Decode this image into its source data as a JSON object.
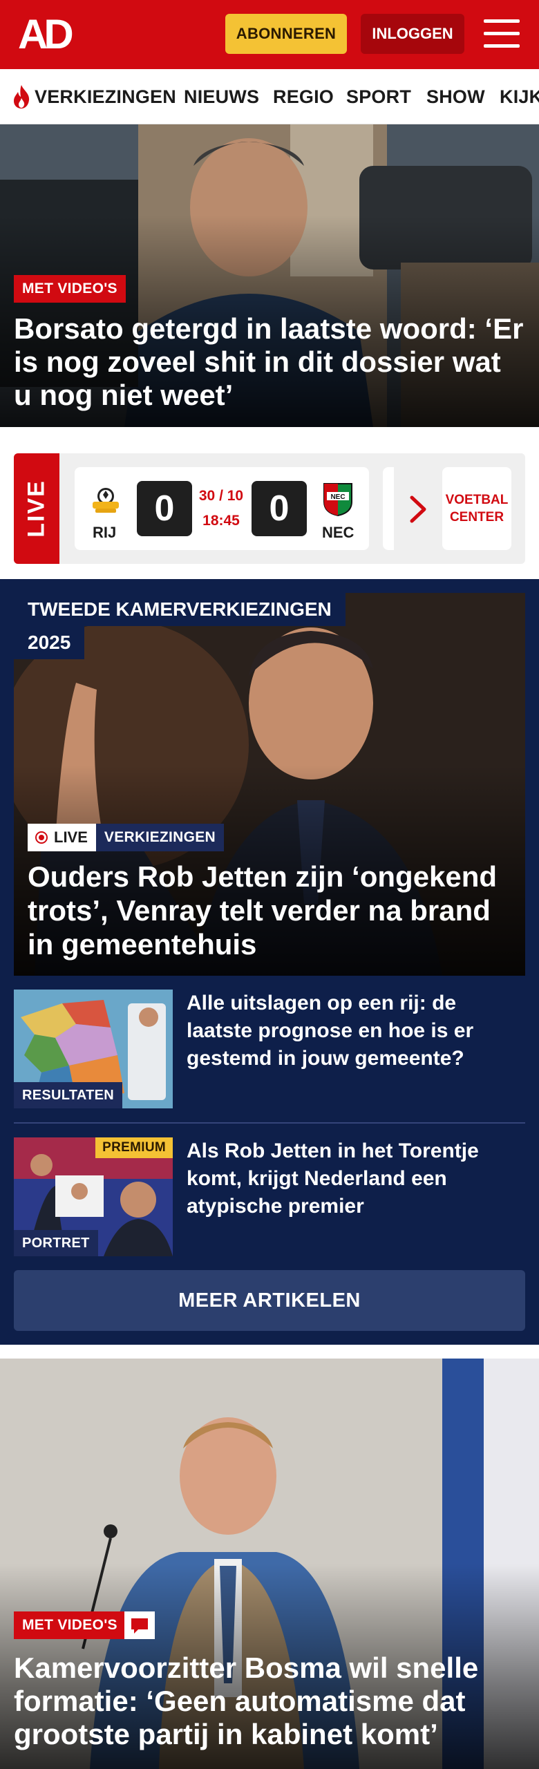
{
  "header": {
    "logo_text": "AD",
    "subscribe_label": "ABONNEREN",
    "login_label": "INLOGGEN",
    "brand_color": "#d10a11"
  },
  "nav": {
    "items": [
      {
        "label": "VERKIEZINGEN",
        "icon": "flame-icon"
      },
      {
        "label": "NIEUWS"
      },
      {
        "label": "REGIO"
      },
      {
        "label": "SPORT"
      },
      {
        "label": "SHOW"
      },
      {
        "label": "KIJK"
      }
    ]
  },
  "hero": {
    "badge": "MET VIDEO'S",
    "title": "Borsato getergd in laatste woord: ‘Er is nog zoveel shit in dit dossier wat u nog niet weet’"
  },
  "live_widget": {
    "tab_label": "LIVE",
    "match": {
      "home_team": "RIJ",
      "away_team": "NEC",
      "home_score": "0",
      "away_score": "0",
      "date": "30 / 10",
      "time": "18:45"
    },
    "center_label_line1": "VOETBAL",
    "center_label_line2": "CENTER"
  },
  "election": {
    "section_label_line1": "TWEEDE KAMERVERKIEZINGEN",
    "section_label_line2": "2025",
    "live_badge": "LIVE",
    "category_badge": "VERKIEZINGEN",
    "title": "Ouders Rob Jetten zijn ‘ongekend trots’, Venray telt verder na brand in gemeentehuis",
    "articles": [
      {
        "label": "RESULTATEN",
        "title": "Alle uitslagen op een rij: de laatste prognose en hoe is er gestemd in jouw gemeente?"
      },
      {
        "label": "PORTRET",
        "premium": "PREMIUM",
        "title": "Als Rob Jetten in het Torentje komt, krijgt Nederland een atypische premier"
      }
    ],
    "more_label": "MEER ARTIKELEN"
  },
  "hero2": {
    "badge": "MET VIDEO'S",
    "title": "Kamervoorzitter Bosma wil snelle formatie: ‘Geen automatisme dat grootste partij in kabinet komt’"
  }
}
